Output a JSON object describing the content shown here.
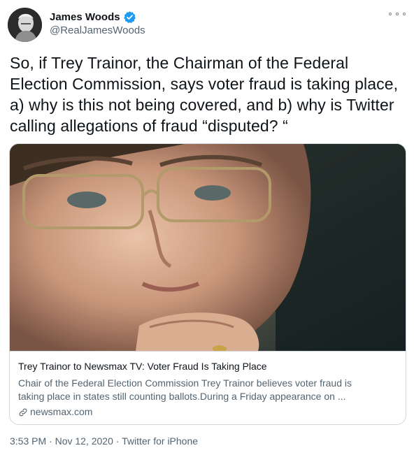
{
  "author": {
    "display_name": "James Woods",
    "handle": "@RealJamesWoods",
    "verified": true,
    "avatar_icon": "avatar-photo"
  },
  "tweet": {
    "text": "So, if Trey Trainor, the Chairman of the Federal Election Commission, says voter fraud is taking place, a) why is this not being covered, and b) why is Twitter calling allegations of fraud “disputed? “"
  },
  "card": {
    "image_icon": "article-photo",
    "title": "Trey Trainor to Newsmax TV: Voter Fraud Is Taking Place",
    "description_line1": "Chair of the Federal Election Commission Trey Trainor believes voter fraud is",
    "description_line2": "taking place in states still counting ballots.During a Friday appearance on ...",
    "domain": "newsmax.com"
  },
  "meta": {
    "time": "3:53 PM",
    "separator": " · ",
    "date": "Nov 12, 2020",
    "source": "Twitter for iPhone"
  },
  "colors": {
    "text_primary": "#0f1419",
    "text_secondary": "#536471",
    "verified_blue": "#1d9bf0",
    "border": "#cfd9de"
  },
  "icons": {
    "more": "more-options-icon",
    "verified": "verified-badge-icon",
    "link": "link-icon"
  }
}
